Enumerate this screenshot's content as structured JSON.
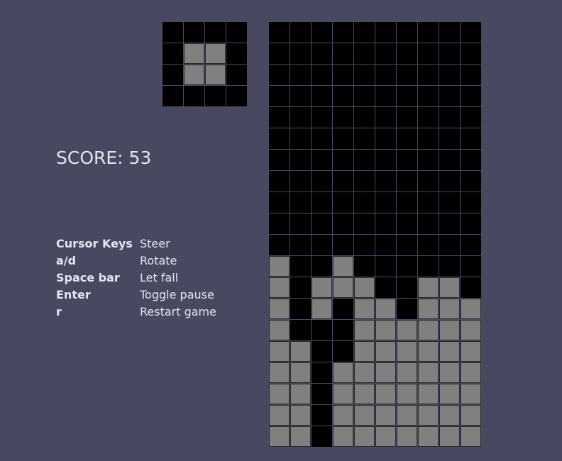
{
  "colors": {
    "background": "#484860",
    "empty_cell": "#000000",
    "filled_cell": "#808080",
    "grid_line": "#4a4a66"
  },
  "score": {
    "label": "SCORE:",
    "value": "53"
  },
  "next_piece": [
    "0000",
    "0110",
    "0110",
    "0000"
  ],
  "board": [
    "0000000000",
    "0000000000",
    "0000000000",
    "0000000000",
    "0000000000",
    "0000000000",
    "0000000000",
    "0000000000",
    "0000000000",
    "0000000000",
    "0000000000",
    "1001000000",
    "1011100110",
    "1010110111",
    "1000111111",
    "1100111111",
    "1101111111",
    "1101111111",
    "1101111111",
    "1101111111"
  ],
  "controls": [
    {
      "key": "Cursor Keys",
      "action": "Steer"
    },
    {
      "key": "a/d",
      "action": "Rotate"
    },
    {
      "key": "Space bar",
      "action": "Let fall"
    },
    {
      "key": "Enter",
      "action": "Toggle pause"
    },
    {
      "key": "r",
      "action": "Restart game"
    }
  ]
}
